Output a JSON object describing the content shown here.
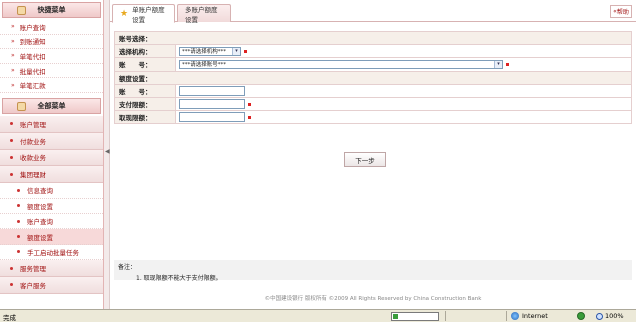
{
  "sidebar": {
    "quick_title": "快捷菜单",
    "quick_items": [
      {
        "label": "账户查询"
      },
      {
        "label": "到账通知"
      },
      {
        "label": "单笔代扣"
      },
      {
        "label": "批量代扣"
      },
      {
        "label": "单笔汇款"
      }
    ],
    "full_title": "全部菜单",
    "menu": {
      "account_mgmt": "账户管理",
      "payment": "付款业务",
      "collection": "收款业务",
      "group_finance": "集团理财",
      "sub_info_query": "信息查询",
      "sub_quota_setting": "额度设置",
      "sub_account_query": "账户查询",
      "sub_quota_setting2": "额度设置",
      "sub_manual_batch": "手工启动批量任务",
      "service_mgmt": "服务管理",
      "customer_service": "客户服务"
    }
  },
  "tabs": {
    "active": "单账户额度设置",
    "inactive": "多账户额度设置",
    "help": "帮助"
  },
  "form": {
    "account_select_section": "账号选择：",
    "institution_label": "选择机构：",
    "institution_value": "***请选择机构***",
    "account_label": "账　　号：",
    "account_value": "***请选择账号***",
    "quota_section": "额度设置：",
    "acct_no_label": "账　　号：",
    "pay_limit_label": "支付限额：",
    "withdraw_limit_label": "取现限额："
  },
  "next_button": "下一步",
  "notes": {
    "title": "备注：",
    "line1": "1. 取现限额不能大于支付限额。"
  },
  "footer": "©中国建设银行 版权所有 ©2009 All Rights Reserved by China Construction Bank",
  "statusbar": {
    "status": "完成",
    "progress": 0.1,
    "zone": "Internet",
    "zoom": "100%"
  },
  "colors": {
    "accent": "#a01010",
    "section_bg": "#f6efe9",
    "required": "#d22222"
  }
}
